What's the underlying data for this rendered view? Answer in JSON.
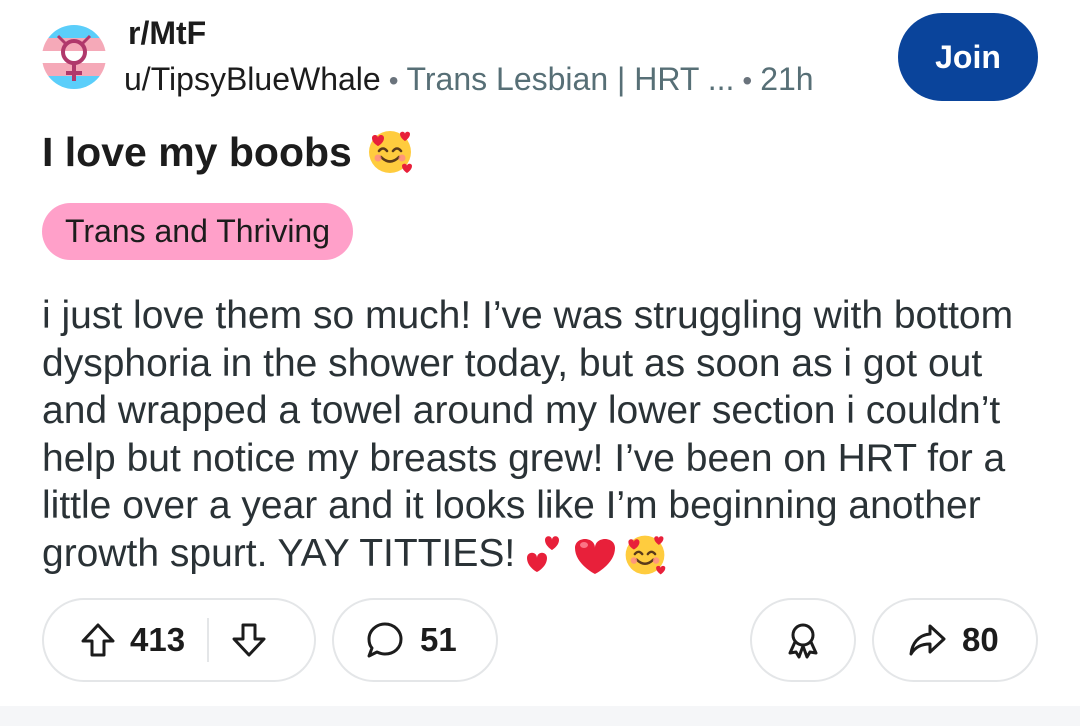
{
  "post": {
    "subreddit": "r/MtF",
    "author": "u/TipsyBlueWhale",
    "user_flair": "Trans Lesbian | HRT ...",
    "time": "21h",
    "join_label": "Join",
    "title": "I love my boobs",
    "post_flair": "Trans and Thriving",
    "body": "i just love them so much! I’ve was struggling with bottom dysphoria in the shower today, but as soon as i got out and wrapped a towel around my lower section i couldn’t help but notice my breasts grew! I’ve been on HRT for a little over a year and it looks like I’m beginning another growth spurt. YAY TITTIES!",
    "upvotes": "413",
    "comments": "51",
    "shares": "80"
  },
  "colors": {
    "join_bg": "#0a449b",
    "flair_bg": "#ffa0c9",
    "trans_blue": "#5bcefa",
    "trans_pink": "#f5a9b8"
  },
  "icons": {
    "avatar": "trans-flag-symbol-icon",
    "title_emoji": "smiling-face-with-hearts-icon",
    "body_emojis": [
      "two-hearts-icon",
      "red-heart-icon",
      "smiling-face-with-hearts-icon"
    ],
    "upvote": "upvote-arrow-icon",
    "downvote": "downvote-arrow-icon",
    "comment": "comment-bubble-icon",
    "award": "award-icon",
    "share": "share-arrow-icon"
  }
}
